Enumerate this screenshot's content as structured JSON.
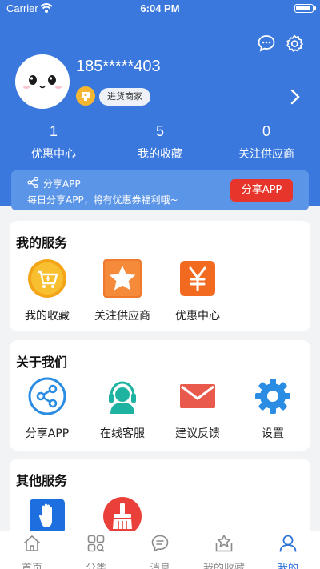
{
  "statusbar": {
    "carrier": "Carrier",
    "time": "6:04 PM"
  },
  "profile": {
    "username": "185*****403",
    "merchant_tag": "进货商家"
  },
  "stats": [
    {
      "value": "1",
      "label": "优惠中心"
    },
    {
      "value": "5",
      "label": "我的收藏"
    },
    {
      "value": "0",
      "label": "关注供应商"
    }
  ],
  "share_banner": {
    "title": "分享APP",
    "desc": "每日分享APP，将有优惠券福利哦~",
    "button": "分享APP"
  },
  "my_services": {
    "title": "我的服务",
    "items": [
      {
        "label": "我的收藏",
        "icon": "cart-icon"
      },
      {
        "label": "关注供应商",
        "icon": "star-icon"
      },
      {
        "label": "优惠中心",
        "icon": "yuan-icon"
      }
    ]
  },
  "about_us": {
    "title": "关于我们",
    "items": [
      {
        "label": "分享APP",
        "icon": "share-icon"
      },
      {
        "label": "在线客服",
        "icon": "headset-icon"
      },
      {
        "label": "建议反馈",
        "icon": "mail-icon"
      },
      {
        "label": "设置",
        "icon": "gear-icon"
      }
    ]
  },
  "other_services": {
    "title": "其他服务",
    "items": [
      {
        "icon": "hand-icon"
      },
      {
        "icon": "broom-icon"
      }
    ]
  },
  "tabbar": {
    "tabs": [
      {
        "label": "首页",
        "icon": "home-icon"
      },
      {
        "label": "分类",
        "icon": "category-icon"
      },
      {
        "label": "消息",
        "icon": "message-icon"
      },
      {
        "label": "我的收藏",
        "icon": "favorite-icon"
      },
      {
        "label": "我的",
        "icon": "user-icon",
        "active": true
      }
    ]
  },
  "colors": {
    "header_blue": "#3a78dd",
    "active_tab": "#2d73db",
    "share_button": "#e8352b"
  }
}
